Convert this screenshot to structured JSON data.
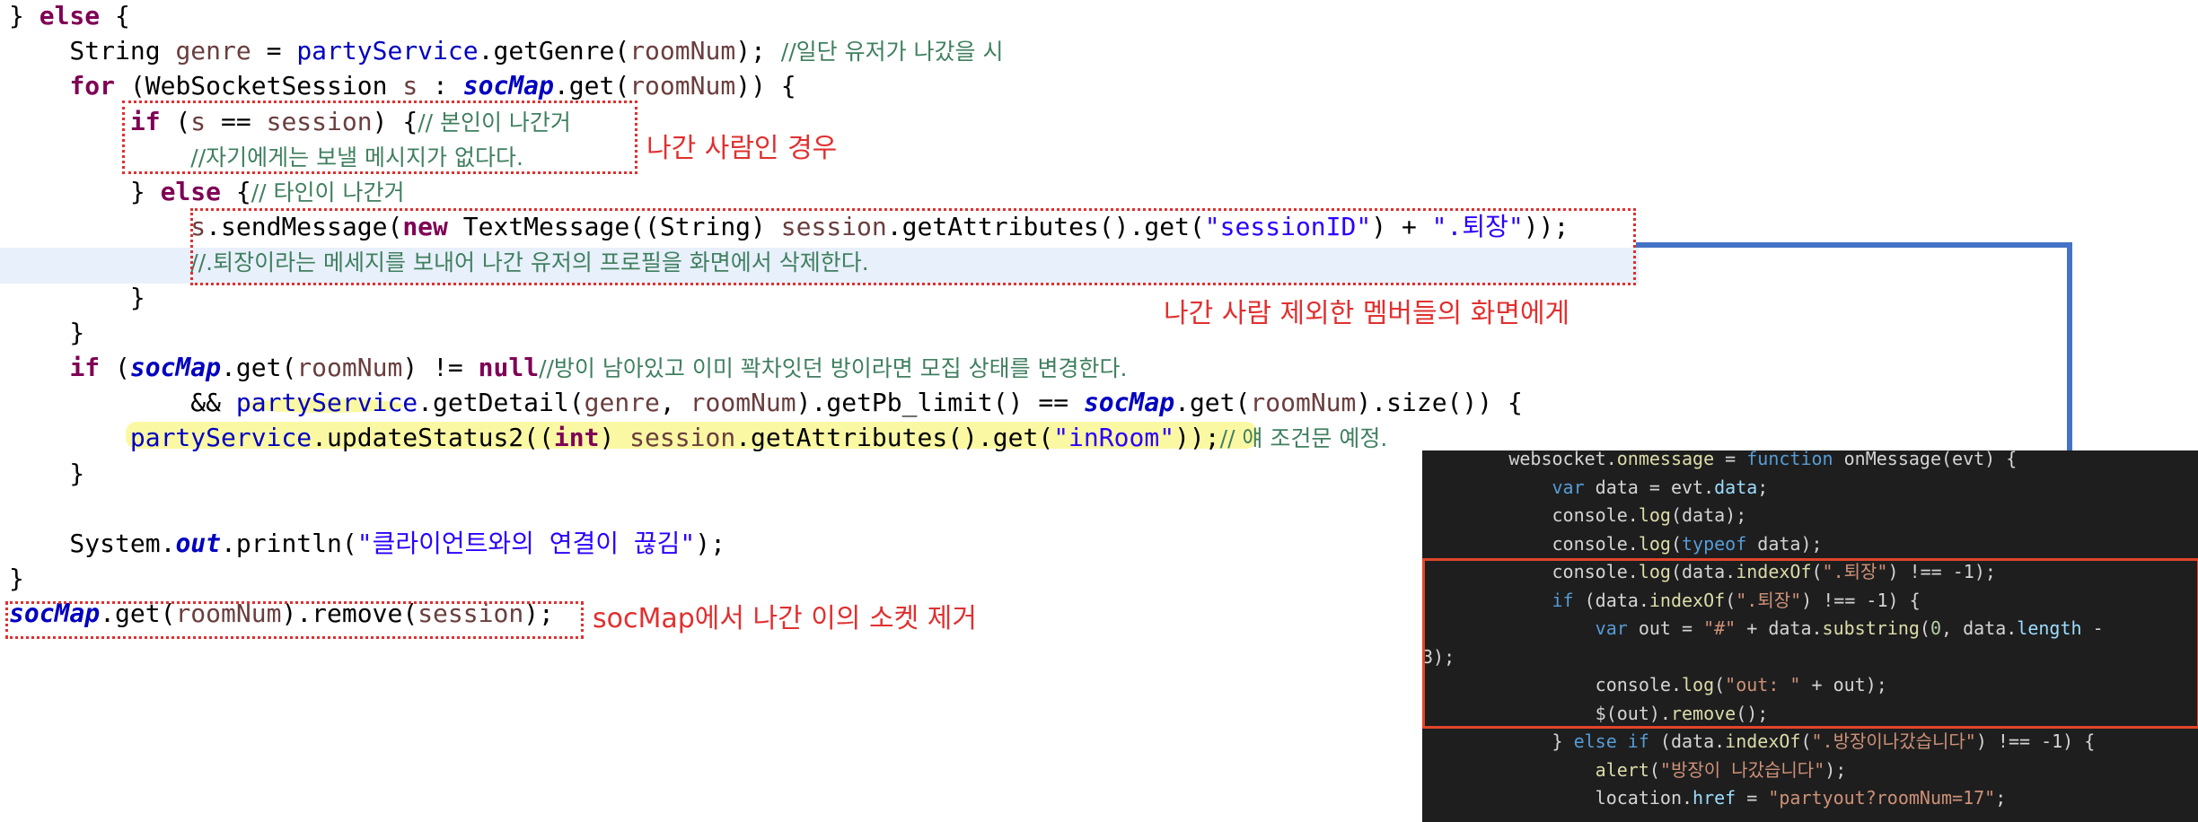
{
  "code_lines": [
    [
      {
        "t": "} ",
        "c": ""
      },
      {
        "t": "else",
        "c": "kw"
      },
      {
        "t": " {",
        "c": ""
      }
    ],
    [
      {
        "t": "    String ",
        "c": ""
      },
      {
        "t": "genre",
        "c": "vr"
      },
      {
        "t": " = ",
        "c": ""
      },
      {
        "t": "partyService",
        "c": "fd"
      },
      {
        "t": ".getGenre(",
        "c": ""
      },
      {
        "t": "roomNum",
        "c": "vr"
      },
      {
        "t": "); ",
        "c": ""
      },
      {
        "t": "//일단 유저가 나갔을 시",
        "c": "cmk"
      }
    ],
    [
      {
        "t": "    ",
        "c": ""
      },
      {
        "t": "for",
        "c": "kw"
      },
      {
        "t": " (WebSocketSession ",
        "c": ""
      },
      {
        "t": "s",
        "c": "vr"
      },
      {
        "t": " : ",
        "c": ""
      },
      {
        "t": "socMap",
        "c": "it"
      },
      {
        "t": ".get(",
        "c": ""
      },
      {
        "t": "roomNum",
        "c": "vr"
      },
      {
        "t": ")) {",
        "c": ""
      }
    ],
    [
      {
        "t": "        ",
        "c": ""
      },
      {
        "t": "if",
        "c": "kw"
      },
      {
        "t": " (",
        "c": ""
      },
      {
        "t": "s",
        "c": "vr"
      },
      {
        "t": " == ",
        "c": ""
      },
      {
        "t": "session",
        "c": "vr"
      },
      {
        "t": ") {",
        "c": ""
      },
      {
        "t": "// 본인이 나간거",
        "c": "cmk"
      }
    ],
    [
      {
        "t": "            ",
        "c": ""
      },
      {
        "t": "//자기에게는 보낼 메시지가 없다다.",
        "c": "cmk"
      }
    ],
    [
      {
        "t": "        } ",
        "c": ""
      },
      {
        "t": "else",
        "c": "kw"
      },
      {
        "t": " {",
        "c": ""
      },
      {
        "t": "// 타인이 나간거",
        "c": "cmk"
      }
    ],
    [
      {
        "t": "            ",
        "c": ""
      },
      {
        "t": "s",
        "c": "vr"
      },
      {
        "t": ".sendMessage(",
        "c": ""
      },
      {
        "t": "new",
        "c": "kw"
      },
      {
        "t": " TextMessage((String) ",
        "c": ""
      },
      {
        "t": "session",
        "c": "vr"
      },
      {
        "t": ".getAttributes().get(",
        "c": ""
      },
      {
        "t": "\"sessionID\"",
        "c": "st"
      },
      {
        "t": ") + ",
        "c": ""
      },
      {
        "t": "\".퇴장\"",
        "c": "st"
      },
      {
        "t": "));",
        "c": ""
      }
    ],
    [
      {
        "t": "            ",
        "c": ""
      },
      {
        "t": "//.퇴장이라는 메세지를 보내어 나간 유저의 프로필을 화면에서 삭제한다.",
        "c": "cmk"
      }
    ],
    [
      {
        "t": "        }",
        "c": ""
      }
    ],
    [
      {
        "t": "    }",
        "c": ""
      }
    ],
    [
      {
        "t": "    ",
        "c": ""
      },
      {
        "t": "if",
        "c": "kw"
      },
      {
        "t": " (",
        "c": ""
      },
      {
        "t": "socMap",
        "c": "it"
      },
      {
        "t": ".get(",
        "c": ""
      },
      {
        "t": "roomNum",
        "c": "vr"
      },
      {
        "t": ") != ",
        "c": ""
      },
      {
        "t": "null",
        "c": "kw"
      },
      {
        "t": "//방이 남아있고 이미 꽉차잇던 방이라면 모집 상태를 변경한다.",
        "c": "cmk"
      }
    ],
    [
      {
        "t": "            && ",
        "c": ""
      },
      {
        "t": "partyService",
        "c": "fd"
      },
      {
        "t": ".getDetail(",
        "c": ""
      },
      {
        "t": "genre",
        "c": "vr"
      },
      {
        "t": ", ",
        "c": ""
      },
      {
        "t": "roomNum",
        "c": "vr"
      },
      {
        "t": ").getPb_limit() == ",
        "c": ""
      },
      {
        "t": "socMap",
        "c": "it"
      },
      {
        "t": ".get(",
        "c": ""
      },
      {
        "t": "roomNum",
        "c": "vr"
      },
      {
        "t": ").size()) {",
        "c": ""
      }
    ],
    [
      {
        "t": "        ",
        "c": ""
      },
      {
        "t": "partyService",
        "c": "fd"
      },
      {
        "t": ".updateStatus2((",
        "c": ""
      },
      {
        "t": "int",
        "c": "kw"
      },
      {
        "t": ") ",
        "c": ""
      },
      {
        "t": "session",
        "c": "vr"
      },
      {
        "t": ".getAttributes().get(",
        "c": ""
      },
      {
        "t": "\"inRoom\"",
        "c": "st"
      },
      {
        "t": "));",
        "c": ""
      },
      {
        "t": "// 얘 조건문 예정.",
        "c": "cmk"
      }
    ],
    [
      {
        "t": "    }",
        "c": ""
      }
    ],
    [
      {
        "t": "",
        "c": ""
      }
    ],
    [
      {
        "t": "    System.",
        "c": ""
      },
      {
        "t": "out",
        "c": "it"
      },
      {
        "t": ".println(",
        "c": ""
      },
      {
        "t": "\"클라이언트와의 연결이 끊김\"",
        "c": "st"
      },
      {
        "t": ");",
        "c": ""
      }
    ],
    [
      {
        "t": "}",
        "c": ""
      }
    ],
    [
      {
        "t": "socMap",
        "c": "it"
      },
      {
        "t": ".get(",
        "c": ""
      },
      {
        "t": "roomNum",
        "c": "vr"
      },
      {
        "t": ").remove(",
        "c": ""
      },
      {
        "t": "session",
        "c": "vr"
      },
      {
        "t": ");",
        "c": ""
      }
    ]
  ],
  "annotations": {
    "self_leave": "나간 사람인 경우",
    "others_screen": "나간 사람 제외한 멤버들의 화면에게",
    "remove_socket": "socMap에서 나간 이의 소켓 제거"
  },
  "js_lines": [
    [
      {
        "t": "        websocket.",
        "c": ""
      },
      {
        "t": "onmessage",
        "c": "jf"
      },
      {
        "t": " = ",
        "c": ""
      },
      {
        "t": "function",
        "c": "jk"
      },
      {
        "t": " onMessage(evt) {",
        "c": ""
      }
    ],
    [
      {
        "t": "            ",
        "c": ""
      },
      {
        "t": "var",
        "c": "jk"
      },
      {
        "t": " data = evt.",
        "c": ""
      },
      {
        "t": "data",
        "c": "jp"
      },
      {
        "t": ";",
        "c": ""
      }
    ],
    [
      {
        "t": "            console.",
        "c": ""
      },
      {
        "t": "log",
        "c": "jf"
      },
      {
        "t": "(data);",
        "c": ""
      }
    ],
    [
      {
        "t": "            console.",
        "c": ""
      },
      {
        "t": "log",
        "c": "jf"
      },
      {
        "t": "(",
        "c": ""
      },
      {
        "t": "typeof",
        "c": "jk"
      },
      {
        "t": " data);",
        "c": ""
      }
    ],
    [
      {
        "t": "            console.",
        "c": ""
      },
      {
        "t": "log",
        "c": "jf"
      },
      {
        "t": "(data.",
        "c": ""
      },
      {
        "t": "indexOf",
        "c": "jf"
      },
      {
        "t": "(",
        "c": ""
      },
      {
        "t": "\".퇴장\"",
        "c": "js"
      },
      {
        "t": ") !== -1);",
        "c": ""
      }
    ],
    [
      {
        "t": "            ",
        "c": ""
      },
      {
        "t": "if",
        "c": "jk"
      },
      {
        "t": " (data.",
        "c": ""
      },
      {
        "t": "indexOf",
        "c": "jf"
      },
      {
        "t": "(",
        "c": ""
      },
      {
        "t": "\".퇴장\"",
        "c": "js"
      },
      {
        "t": ") !== -1) {",
        "c": ""
      }
    ],
    [
      {
        "t": "                ",
        "c": ""
      },
      {
        "t": "var",
        "c": "jk"
      },
      {
        "t": " out = ",
        "c": ""
      },
      {
        "t": "\"#\"",
        "c": "js"
      },
      {
        "t": " + data.",
        "c": ""
      },
      {
        "t": "substring",
        "c": "jf"
      },
      {
        "t": "(",
        "c": ""
      },
      {
        "t": "0",
        "c": "jn"
      },
      {
        "t": ", data.",
        "c": ""
      },
      {
        "t": "length",
        "c": "jp"
      },
      {
        "t": " -",
        "c": ""
      }
    ],
    [
      {
        "t": "3);",
        "c": ""
      }
    ],
    [
      {
        "t": "                console.",
        "c": ""
      },
      {
        "t": "log",
        "c": "jf"
      },
      {
        "t": "(",
        "c": ""
      },
      {
        "t": "\"out: \"",
        "c": "js"
      },
      {
        "t": " + out);",
        "c": ""
      }
    ],
    [
      {
        "t": "                $(out).",
        "c": ""
      },
      {
        "t": "remove",
        "c": "jf"
      },
      {
        "t": "();",
        "c": ""
      }
    ],
    [
      {
        "t": "            } ",
        "c": ""
      },
      {
        "t": "else if",
        "c": "jk"
      },
      {
        "t": " (data.",
        "c": ""
      },
      {
        "t": "indexOf",
        "c": "jf"
      },
      {
        "t": "(",
        "c": ""
      },
      {
        "t": "\".방장이나갔습니다\"",
        "c": "js"
      },
      {
        "t": ") !== -1) {",
        "c": ""
      }
    ],
    [
      {
        "t": "                ",
        "c": ""
      },
      {
        "t": "alert",
        "c": "jf"
      },
      {
        "t": "(",
        "c": ""
      },
      {
        "t": "\"방장이 나갔습니다\"",
        "c": "js"
      },
      {
        "t": ");",
        "c": ""
      }
    ],
    [
      {
        "t": "                location.",
        "c": ""
      },
      {
        "t": "href",
        "c": "jp"
      },
      {
        "t": " = ",
        "c": ""
      },
      {
        "t": "\"partyout?roomNum=17\"",
        "c": "js"
      },
      {
        "t": ";",
        "c": ""
      }
    ]
  ],
  "colors": {
    "annotation_red": "#e03030",
    "arrow_blue": "#4472c4",
    "highlight_yellow": "#f7f25a",
    "editor_dark": "#1e1e1e"
  }
}
